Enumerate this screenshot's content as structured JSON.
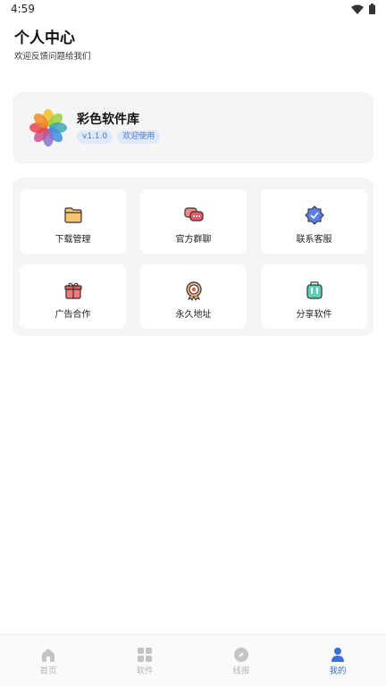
{
  "status_bar": {
    "time": "4:59"
  },
  "header": {
    "title": "个人中心",
    "subtitle": "欢迎反馈问题给我们"
  },
  "app_card": {
    "name": "彩色软件库",
    "version": "v1.1.0",
    "welcome": "欢迎使用"
  },
  "grid": {
    "items": [
      {
        "label": "下载管理",
        "icon": "folder-icon"
      },
      {
        "label": "官方群聊",
        "icon": "chat-icon"
      },
      {
        "label": "联系客服",
        "icon": "verified-badge-icon"
      },
      {
        "label": "广告合作",
        "icon": "gift-icon"
      },
      {
        "label": "永久地址",
        "icon": "target-icon"
      },
      {
        "label": "分享软件",
        "icon": "share-bag-icon"
      }
    ]
  },
  "bottom_nav": {
    "items": [
      {
        "label": "首页",
        "icon": "home-icon"
      },
      {
        "label": "软件",
        "icon": "grid-icon"
      },
      {
        "label": "线报",
        "icon": "compass-icon"
      },
      {
        "label": "我的",
        "icon": "user-icon",
        "active": true
      }
    ]
  },
  "colors": {
    "accent": "#3a6fd8",
    "badge_bg": "#dfe9fa",
    "panel_bg": "#f5f5f5",
    "inactive_nav": "#b5b5b5"
  }
}
